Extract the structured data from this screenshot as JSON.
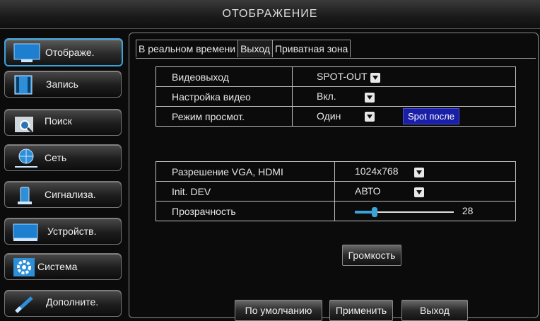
{
  "window": {
    "title": "ОТОБРАЖЕНИЕ"
  },
  "sidebar": {
    "items": [
      {
        "label": "Отображе.",
        "icon": "monitor-icon"
      },
      {
        "label": "Запись",
        "icon": "film-icon"
      },
      {
        "label": "Поиск",
        "icon": "magnifier-icon"
      },
      {
        "label": "Сеть",
        "icon": "network-globe-icon"
      },
      {
        "label": "Сигнализа.",
        "icon": "alarm-icon"
      },
      {
        "label": "Устройств.",
        "icon": "device-icon"
      },
      {
        "label": "Система",
        "icon": "gear-icon"
      },
      {
        "label": "Дополните.",
        "icon": "wand-icon"
      }
    ]
  },
  "tabs": [
    {
      "label": "В реальном времени"
    },
    {
      "label": "Выход"
    },
    {
      "label": "Приватная зона"
    }
  ],
  "output_table": {
    "video_out_label": "Видеовыход",
    "video_out_value": "SPOT-OUT",
    "video_setup_label": "Настройка видео",
    "video_setup_value": "Вкл.",
    "view_mode_label": "Режим просмот.",
    "view_mode_value": "Один",
    "spot_after_button": "Spot после"
  },
  "display_table": {
    "resolution_label": "Разрешение VGA, HDMI",
    "resolution_value": "1024x768",
    "init_dev_label": "Init. DEV",
    "init_dev_value": "АВТО",
    "transparency_label": "Прозрачность",
    "transparency_value": "28",
    "transparency_fraction": 0.2
  },
  "buttons": {
    "volume": "Громкость",
    "default": "По умолчанию",
    "apply": "Применить",
    "exit": "Выход"
  },
  "colors": {
    "accent": "#3aa3d8",
    "spot_button": "#1a1fa8"
  }
}
